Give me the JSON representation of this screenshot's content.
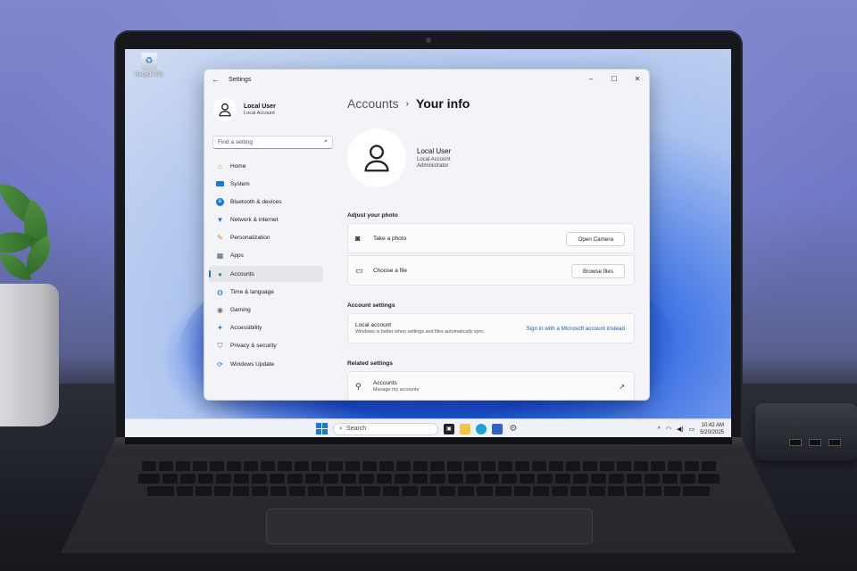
{
  "desktop": {
    "recycle_bin_label": "Recycle Bin"
  },
  "window": {
    "title": "Settings",
    "controls": {
      "minimize": "–",
      "maximize": "☐",
      "close": "✕"
    }
  },
  "sidebar": {
    "user_name": "Local User",
    "user_type": "Local Account",
    "search_placeholder": "Find a setting",
    "items": [
      {
        "label": "Home",
        "icon": "home-icon",
        "color": "#d9822b"
      },
      {
        "label": "System",
        "icon": "system-icon",
        "color": "#1a78d6"
      },
      {
        "label": "Bluetooth & devices",
        "icon": "bluetooth-icon",
        "color": "#1a78d6"
      },
      {
        "label": "Network & internet",
        "icon": "wifi-icon",
        "color": "#1a78d6"
      },
      {
        "label": "Personalization",
        "icon": "brush-icon",
        "color": "#d9822b"
      },
      {
        "label": "Apps",
        "icon": "apps-icon",
        "color": "#4a5a7a"
      },
      {
        "label": "Accounts",
        "icon": "account-icon",
        "color": "#2e9e5a",
        "selected": true
      },
      {
        "label": "Time & language",
        "icon": "globe-icon",
        "color": "#1a78d6"
      },
      {
        "label": "Gaming",
        "icon": "gamepad-icon",
        "color": "#6a6f78"
      },
      {
        "label": "Accessibility",
        "icon": "accessibility-icon",
        "color": "#1a78d6"
      },
      {
        "label": "Privacy & security",
        "icon": "shield-icon",
        "color": "#6a6f78"
      },
      {
        "label": "Windows Update",
        "icon": "update-icon",
        "color": "#1a78d6"
      }
    ]
  },
  "main": {
    "breadcrumb_parent": "Accounts",
    "breadcrumb_separator": "›",
    "breadcrumb_current": "Your info",
    "user_name": "Local User",
    "user_type": "Local Account",
    "user_role": "Administrator",
    "adjust_photo_heading": "Adjust your photo",
    "take_photo_label": "Take a photo",
    "open_camera_button": "Open Camera",
    "choose_file_label": "Choose a file",
    "browse_files_button": "Browse files",
    "account_settings_heading": "Account settings",
    "local_account_label": "Local account",
    "local_account_desc": "Windows is better when settings and files automatically sync",
    "microsoft_signin_link": "Sign in with a Microsoft account instead",
    "related_settings_heading": "Related settings",
    "related_accounts_label": "Accounts",
    "related_accounts_desc": "Manage my accounts"
  },
  "taskbar": {
    "search_label": "Search",
    "time": "10:42 AM",
    "date": "5/20/2025"
  }
}
